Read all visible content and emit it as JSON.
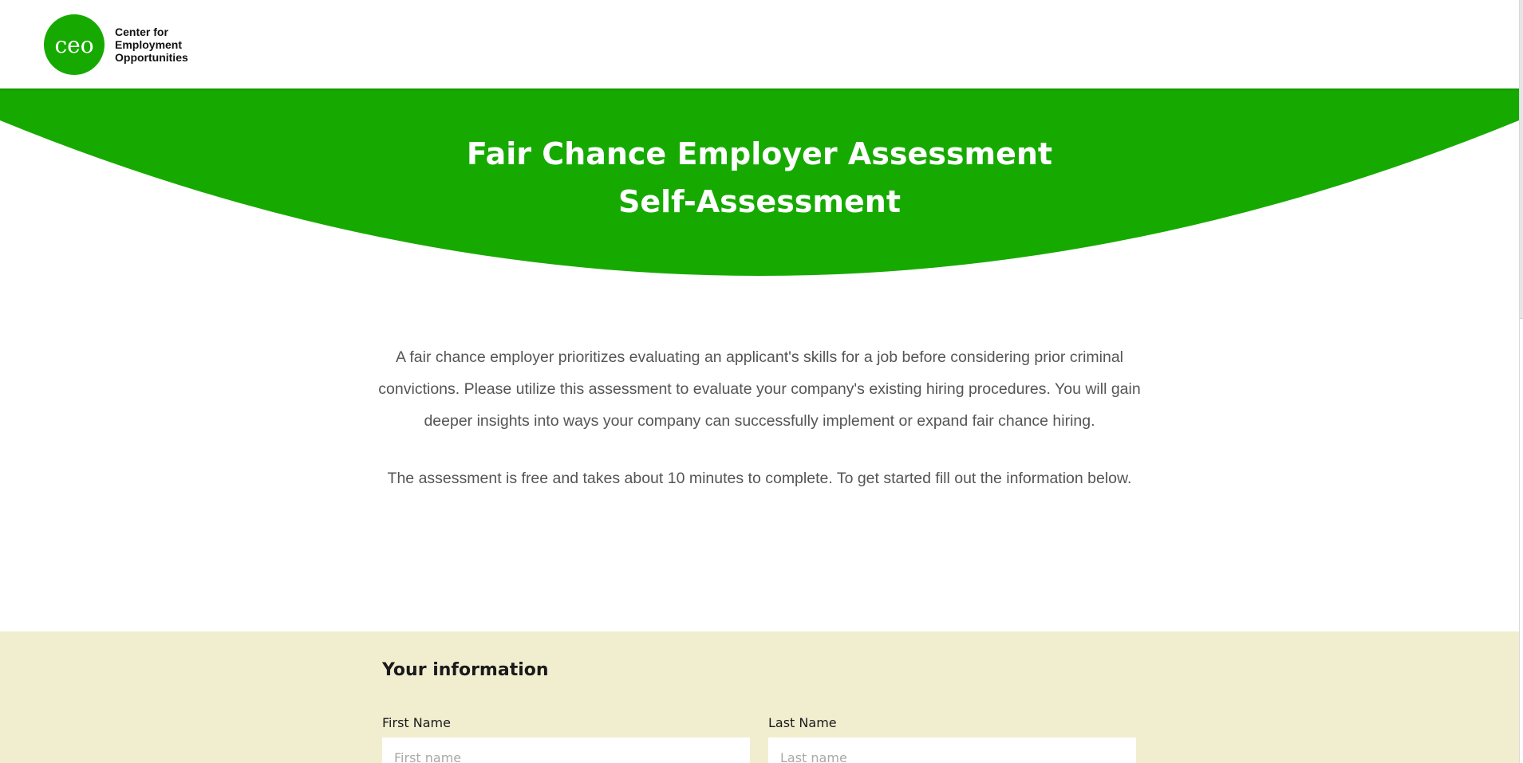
{
  "logo": {
    "mark": "ceo",
    "name_lines": [
      "Center for",
      "Employment",
      "Opportunities"
    ]
  },
  "hero": {
    "title_line1": "Fair Chance Employer Assessment",
    "title_line2": "Self-Assessment",
    "background_color": "#16aa00"
  },
  "intro": {
    "paragraph1": "A fair chance employer prioritizes evaluating an applicant's skills for a job before considering prior criminal convictions. Please utilize this assessment to evaluate your company's existing hiring procedures. You will gain deeper insights into ways your company can successfully implement or expand fair chance hiring.",
    "paragraph2": "The assessment is free and takes about 10 minutes to complete. To get started fill out the information below."
  },
  "form": {
    "heading": "Your information",
    "section_background": "#f1eed0",
    "first_name": {
      "label": "First Name",
      "placeholder": "First name",
      "value": ""
    },
    "last_name": {
      "label": "Last Name",
      "placeholder": "Last name",
      "value": ""
    }
  },
  "colors": {
    "brand_green": "#16aa00",
    "body_text": "#555555",
    "form_bg": "#f1eed0"
  }
}
